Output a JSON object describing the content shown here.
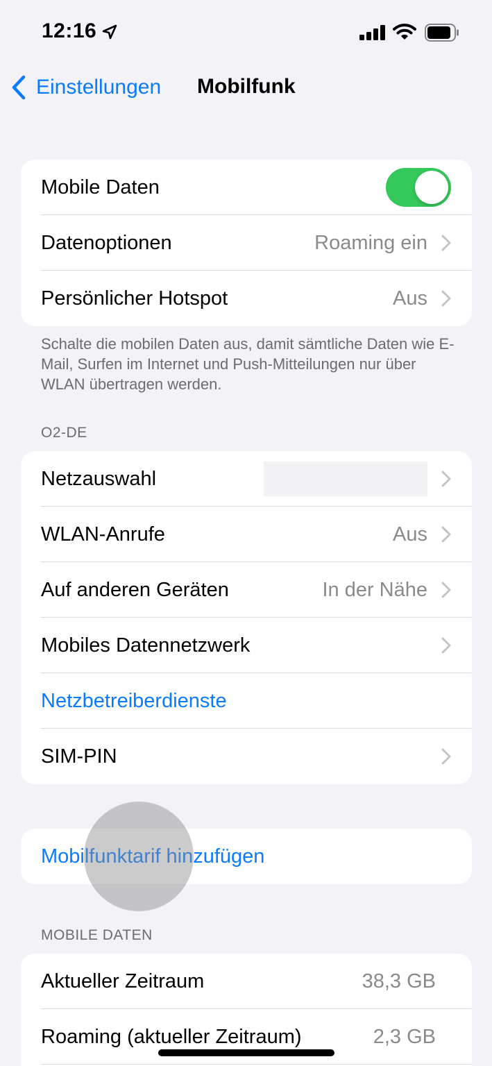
{
  "status_bar": {
    "time": "12:16",
    "location_icon": "location-arrow-icon",
    "signal_icon": "cellular-signal-icon",
    "wifi_icon": "wifi-icon",
    "battery_icon": "battery-icon"
  },
  "nav": {
    "back_label": "Einstellungen",
    "title": "Mobilfunk"
  },
  "group1": {
    "mobile_data_label": "Mobile Daten",
    "mobile_data_on": true,
    "data_options_label": "Datenoptionen",
    "data_options_value": "Roaming ein",
    "hotspot_label": "Persönlicher Hotspot",
    "hotspot_value": "Aus"
  },
  "group1_footer": "Schalte die mobilen Daten aus, damit sämtliche Daten wie E-Mail, Surfen im Internet und Push-Mitteilungen nur über WLAN übertragen werden.",
  "carrier_header": "O2-DE",
  "group2": {
    "network_selection_label": "Netzauswahl",
    "wifi_calling_label": "WLAN-Anrufe",
    "wifi_calling_value": "Aus",
    "other_devices_label": "Auf anderen Geräten",
    "other_devices_value": "In der Nähe",
    "mobile_data_network_label": "Mobiles Datennetzwerk",
    "carrier_services_label": "Netzbetreiberdienste",
    "sim_pin_label": "SIM-PIN"
  },
  "add_plan_label": "Mobilfunktarif hinzufügen",
  "mobile_data_header": "MOBILE DATEN",
  "usage": {
    "current_period_label": "Aktueller Zeitraum",
    "current_period_value": "38,3 GB",
    "roaming_label": "Roaming (aktueller Zeitraum)",
    "roaming_value": "2,3 GB"
  },
  "colors": {
    "accent": "#0a7aff",
    "toggle_on": "#34c759",
    "background": "#f2f2f7",
    "secondary_text": "#8a8a8e"
  }
}
